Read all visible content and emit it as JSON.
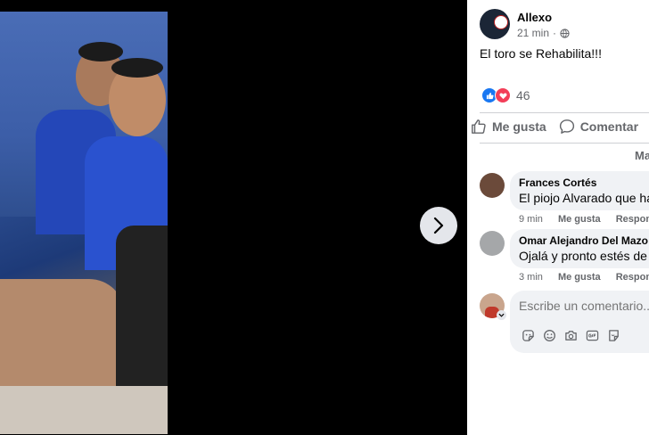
{
  "viewer": {
    "next_icon": "chevron-right-icon"
  },
  "post": {
    "author": "Allexo",
    "time": "21 min",
    "privacy_icon": "globe-icon",
    "text": "El toro se Rehabilita!!!",
    "reaction_icons": [
      "like-icon",
      "love-icon"
    ],
    "reaction_count": "46"
  },
  "actions": {
    "like_label": "Me gusta",
    "comment_label": "Comentar",
    "share_icon": "share-icon"
  },
  "sort_label": "Ma",
  "comments": [
    {
      "name": "Frances Cortés",
      "text": "El piojo Alvarado que hac",
      "time": "9 min",
      "like": "Me gusta",
      "reply": "Respond"
    },
    {
      "name": "Omar Alejandro Del Mazo N",
      "text": "Ojalá y pronto estés de n",
      "time": "3 min",
      "like": "Me gusta",
      "reply": "Respond"
    }
  ],
  "composer": {
    "placeholder": "Escribe un comentario...",
    "icons": [
      "sticker-icon",
      "emoji-icon",
      "camera-icon",
      "gif-icon",
      "sticker-alt-icon"
    ]
  },
  "colors": {
    "brand": "#1877f2",
    "love": "#f33e58",
    "muted_text": "#65676b",
    "bubble_bg": "#f0f2f5"
  }
}
